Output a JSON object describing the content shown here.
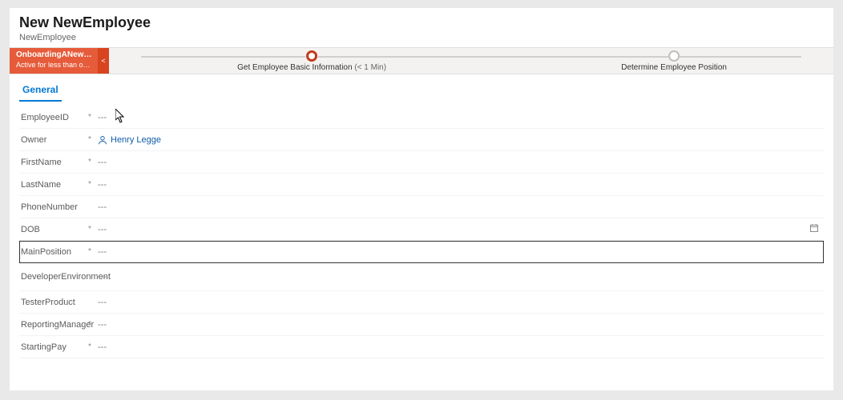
{
  "header": {
    "title": "New NewEmployee",
    "subtitle": "NewEmployee"
  },
  "bpf": {
    "flag": {
      "line1": "OnboardingANewEmplo...",
      "line2": "Active for less than one mi..."
    },
    "stages": [
      {
        "label": "Get Employee Basic Information",
        "time": "(< 1 Min)",
        "active": true
      },
      {
        "label": "Determine Employee Position",
        "time": "",
        "active": false
      }
    ]
  },
  "tab": {
    "general": "General"
  },
  "fields": {
    "employeeId": {
      "label": "EmployeeID",
      "required": true,
      "value": "---"
    },
    "owner": {
      "label": "Owner",
      "required": true,
      "value": "Henry Legge",
      "isLookup": true
    },
    "firstName": {
      "label": "FirstName",
      "required": true,
      "value": "---"
    },
    "lastName": {
      "label": "LastName",
      "required": true,
      "value": "---"
    },
    "phoneNumber": {
      "label": "PhoneNumber",
      "required": false,
      "value": "---"
    },
    "dob": {
      "label": "DOB",
      "required": true,
      "value": "---",
      "hasDatePicker": true
    },
    "mainPosition": {
      "label": "MainPosition",
      "required": true,
      "value": "---",
      "selected": true
    },
    "devEnvironment": {
      "label": "DeveloperEnvironment",
      "required": false,
      "value": "---"
    },
    "testerProduct": {
      "label": "TesterProduct",
      "required": false,
      "value": "---"
    },
    "reportingManager": {
      "label": "ReportingManager",
      "required": true,
      "value": "---"
    },
    "startingPay": {
      "label": "StartingPay",
      "required": true,
      "value": "---"
    }
  },
  "glyphs": {
    "chevronLeft": "<",
    "requiredMark": "*"
  }
}
